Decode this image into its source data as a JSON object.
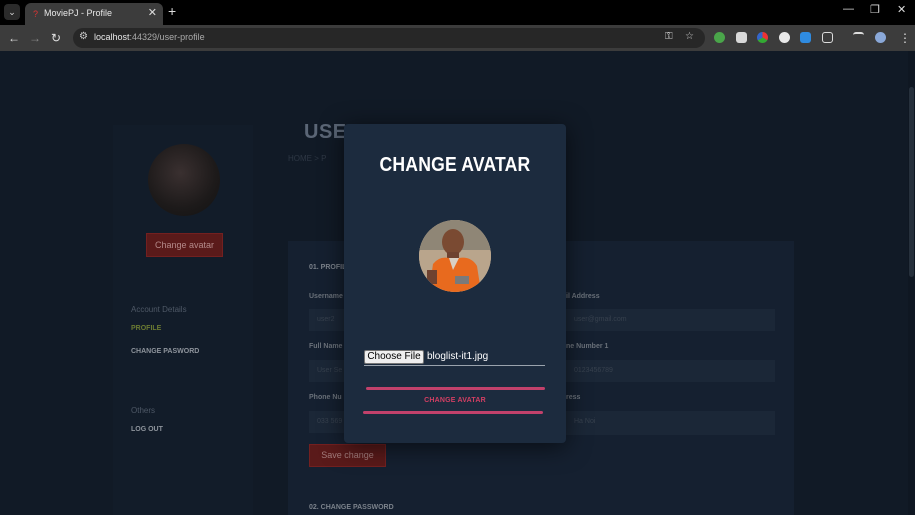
{
  "browser": {
    "tab_title": "MoviePJ - Profile",
    "url_host": "localhost",
    "url_path": ":44329/user-profile"
  },
  "sidebar": {
    "change_avatar_label": "Change avatar",
    "account_heading": "Account Details",
    "profile_link": "PROFILE",
    "change_password_link": "CHANGE PASWORD",
    "others_heading": "Others",
    "logout_link": "LOG OUT"
  },
  "main": {
    "title": "USER",
    "breadcrumb": "HOME   >   P",
    "section_profile": "01. PROFIL",
    "label_username": "Username",
    "value_username": "user2",
    "label_fullname": "Full Name",
    "value_fullname": "User Se",
    "label_phone": "Phone Nu",
    "value_phone": "033 569",
    "label_email": "il Address",
    "value_email": "user@gmail.com",
    "label_phone2": "ne Number 1",
    "value_phone2": "0123456789",
    "label_address": "ress",
    "value_address": "Ha Noi",
    "save_label": "Save change",
    "section_password": "02. CHANGE PASSWORD"
  },
  "modal": {
    "title": "CHANGE AVATAR",
    "choose_file_label": "Choose File",
    "file_name": "bloglist-it1.jpg",
    "submit_label": "CHANGE AVATAR",
    "accent_color": "#c2416b"
  }
}
